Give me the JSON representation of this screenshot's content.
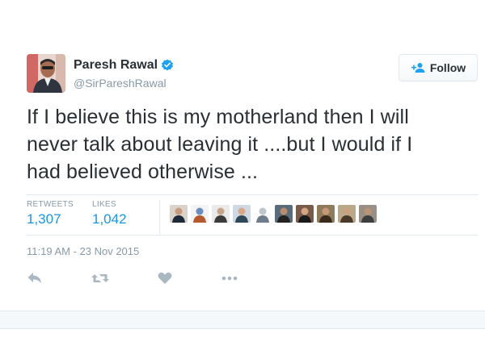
{
  "user": {
    "display_name": "Paresh Rawal",
    "handle": "@SirPareshRawal",
    "verified": true
  },
  "follow_button": {
    "label": "Follow",
    "icon": "add-user-icon"
  },
  "tweet": {
    "lines": [
      "If I believe this is my motherland then I will",
      "never talk about leaving it ....but I would if I",
      "had believed otherwise ..."
    ]
  },
  "stats": {
    "retweets_label": "RETWEETS",
    "retweets_count": "1,307",
    "likes_label": "LIKES",
    "likes_count": "1,042",
    "liker_avatar_count": 10
  },
  "timestamp": "11:19 AM - 23 Nov 2015",
  "actions": [
    "reply-icon",
    "retweet-icon",
    "like-icon",
    "more-icon"
  ],
  "colors": {
    "link_blue": "#1b95e0",
    "muted_gray": "#8899a6",
    "text_dark": "#292f33",
    "border": "#e1e8ed",
    "verified_blue": "#1da1f2"
  }
}
